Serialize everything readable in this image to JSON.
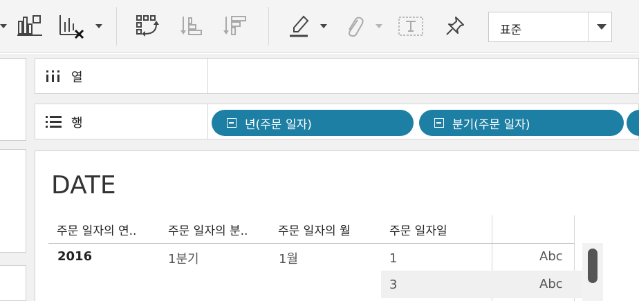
{
  "toolbar": {
    "format_select": {
      "value": "표준"
    },
    "icons": [
      "show-me-icon",
      "clear-sheet-icon",
      "swap-icon",
      "sort-ascending-icon",
      "sort-descending-icon",
      "highlight-icon",
      "attach-icon",
      "text-box-icon",
      "pin-icon"
    ]
  },
  "shelves": {
    "columns": {
      "label": "열",
      "icon": "columns-icon"
    },
    "rows": {
      "label": "행",
      "icon": "rows-icon",
      "pills": [
        "년(주문 일자)",
        "분기(주문 일자)"
      ]
    }
  },
  "sheet": {
    "title": "DATE",
    "columns": [
      "주문 일자의 연..",
      "주문 일자의 분..",
      "주문 일자의 월",
      "주문 일자일"
    ],
    "rows": [
      {
        "year": "2016",
        "quarter": "1분기",
        "month": "1월",
        "day": "1",
        "value": "Abc"
      },
      {
        "year": "",
        "quarter": "",
        "month": "",
        "day": "3",
        "value": "Abc"
      }
    ]
  },
  "colors": {
    "pill": "#1d7fa3",
    "toolbar_bg": "#f4f4f4"
  }
}
